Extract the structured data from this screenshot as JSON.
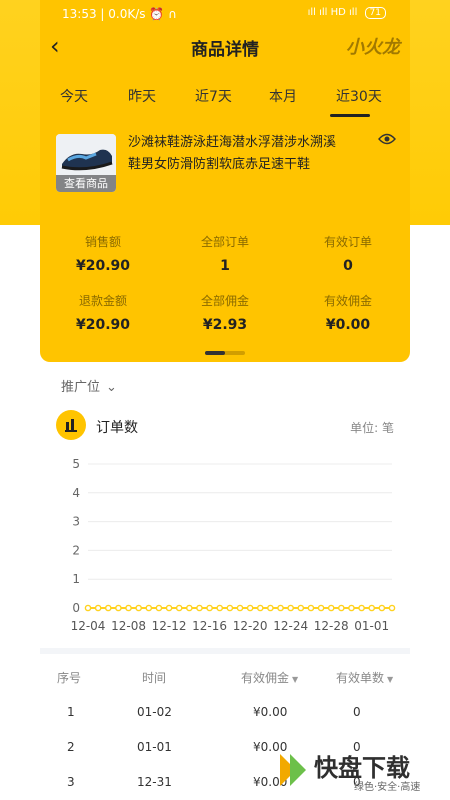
{
  "status_bar": {
    "time": "13:53",
    "network": "0.0K/s",
    "signals": "ıll ıll HD ıll",
    "battery": "71"
  },
  "header": {
    "back_icon": "back-arrow-icon",
    "title": "商品详情",
    "logo_text": "小火龙"
  },
  "tabs": [
    {
      "label": "今天",
      "active": false
    },
    {
      "label": "昨天",
      "active": false
    },
    {
      "label": "近7天",
      "active": false
    },
    {
      "label": "本月",
      "active": false
    },
    {
      "label": "近30天",
      "active": true
    }
  ],
  "product": {
    "thumb_label": "查看商品",
    "title_line1": "沙滩袜鞋游泳赶海潜水浮潜涉水溯溪",
    "title_line2": "鞋男女防滑防割软底赤足速干鞋",
    "eye_icon": "eye-icon"
  },
  "stats": [
    {
      "label": "销售额",
      "value": "¥20.90"
    },
    {
      "label": "全部订单",
      "value": "1"
    },
    {
      "label": "有效订单",
      "value": "0"
    },
    {
      "label": "退款金额",
      "value": "¥20.90"
    },
    {
      "label": "全部佣金",
      "value": "¥2.93"
    },
    {
      "label": "有效佣金",
      "value": "¥0.00"
    }
  ],
  "filter": {
    "label": "推广位"
  },
  "chart_section": {
    "title": "订单数",
    "unit": "单位: 笔"
  },
  "chart_data": {
    "type": "line",
    "title": "订单数",
    "ylabel": "",
    "xlabel": "",
    "ylim": [
      0,
      5
    ],
    "yticks": [
      0,
      1,
      2,
      3,
      4,
      5
    ],
    "xticks": [
      "12-04",
      "12-08",
      "12-12",
      "12-16",
      "12-20",
      "12-24",
      "12-28",
      "01-01"
    ],
    "series": [
      {
        "values": [
          0,
          0,
          0,
          0,
          0,
          0,
          0,
          0,
          0,
          0,
          0,
          0,
          0,
          0,
          0,
          0,
          0,
          0,
          0,
          0,
          0,
          0,
          0,
          0,
          0,
          0,
          0,
          0,
          0,
          0,
          0
        ]
      }
    ],
    "grid": true,
    "color": "#ffd21f"
  },
  "table": {
    "headers": [
      "序号",
      "时间",
      "有效佣金",
      "有效单数"
    ],
    "rows": [
      [
        "1",
        "01-02",
        "¥0.00",
        "0"
      ],
      [
        "2",
        "01-01",
        "¥0.00",
        "0"
      ],
      [
        "3",
        "12-31",
        "¥0.00",
        "0"
      ]
    ]
  },
  "watermark": {
    "text": "快盘下载",
    "sub": "绿色·安全·高速"
  }
}
